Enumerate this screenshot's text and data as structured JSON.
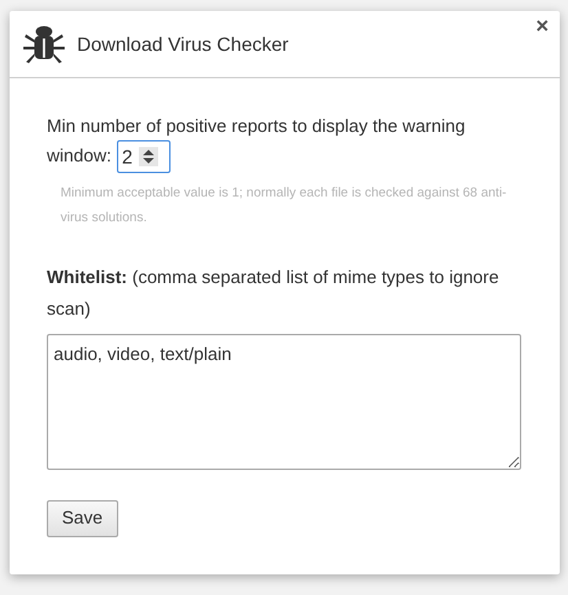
{
  "dialog": {
    "title": "Download Virus Checker",
    "close": "×"
  },
  "min_reports": {
    "label": "Min number of positive reports to display the warning window:",
    "value": "2",
    "hint": "Minimum acceptable value is 1; normally each file is checked against 68 anti-virus solutions."
  },
  "whitelist": {
    "label": "**Whitelist:** (comma separated list of mime types to ignore scan)",
    "value": "audio, video, text/plain"
  },
  "buttons": [
    "Save"
  ]
}
